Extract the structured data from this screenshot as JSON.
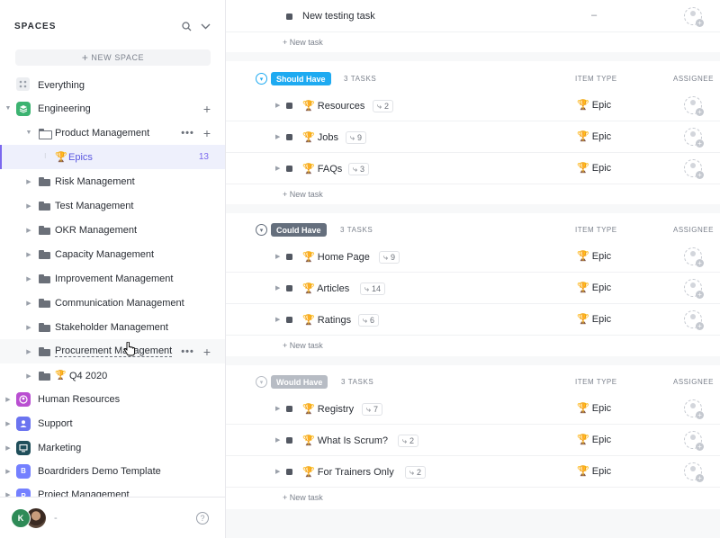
{
  "sidebar": {
    "title": "SPACES",
    "new_space_label": "NEW SPACE",
    "items": [
      {
        "label": "Everything"
      },
      {
        "label": "Engineering"
      },
      {
        "label": "Product Management"
      },
      {
        "label": "Epics",
        "count": "13"
      },
      {
        "label": "Risk Management"
      },
      {
        "label": "Test Management"
      },
      {
        "label": "OKR Management"
      },
      {
        "label": "Capacity Management"
      },
      {
        "label": "Improvement Management"
      },
      {
        "label": "Communication Management"
      },
      {
        "label": "Stakeholder Management"
      },
      {
        "label": "Procurement Management"
      },
      {
        "label": "Q4 2020"
      },
      {
        "label": "Human Resources"
      },
      {
        "label": "Support"
      },
      {
        "label": "Marketing"
      },
      {
        "label": "Boardriders Demo Template",
        "letter": "B"
      },
      {
        "label": "Project Management",
        "letter": "P"
      }
    ],
    "colors": {
      "engineering": "#3cb371",
      "human_resources": "#b94fd1",
      "support": "#6b74f0",
      "marketing": "#1f4e5a",
      "boardriders": "#7480ff",
      "project": "#7480ff"
    },
    "footer": {
      "avatar_letter": "K",
      "status": "-",
      "help": "?"
    }
  },
  "main": {
    "top_task": {
      "name": "New testing task",
      "type": "–"
    },
    "new_task_label": "+ New task",
    "columns": {
      "item_type": "ITEM TYPE",
      "assignee": "ASSIGNEE"
    },
    "groups": [
      {
        "label": "Should Have",
        "count": "3 TASKS",
        "color": "#1eaaf1",
        "tasks": [
          {
            "name": "Resources",
            "subtasks": "2",
            "type": "Epic"
          },
          {
            "name": "Jobs",
            "subtasks": "9",
            "type": "Epic"
          },
          {
            "name": "FAQs",
            "subtasks": "3",
            "type": "Epic"
          }
        ]
      },
      {
        "label": "Could Have",
        "count": "3 TASKS",
        "color": "#656f7d",
        "tasks": [
          {
            "name": "Home Page",
            "subtasks": "9",
            "type": "Epic"
          },
          {
            "name": "Articles",
            "subtasks": "14",
            "type": "Epic"
          },
          {
            "name": "Ratings",
            "subtasks": "6",
            "type": "Epic"
          }
        ]
      },
      {
        "label": "Would Have",
        "count": "3 TASKS",
        "color": "#b7bcc4",
        "tasks": [
          {
            "name": "Registry",
            "subtasks": "7",
            "type": "Epic"
          },
          {
            "name": "What Is Scrum?",
            "subtasks": "2",
            "type": "Epic"
          },
          {
            "name": "For Trainers Only",
            "subtasks": "2",
            "type": "Epic"
          }
        ]
      }
    ]
  }
}
